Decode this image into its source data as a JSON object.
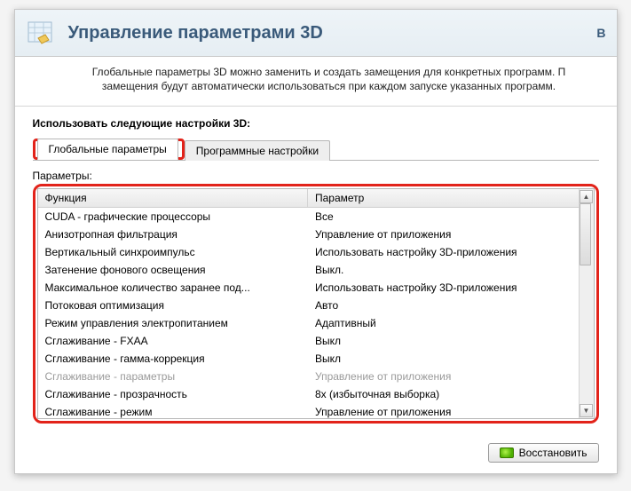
{
  "header": {
    "title": "Управление параметрами 3D",
    "rightChar": "В"
  },
  "description": "Глобальные параметры 3D можно заменить и создать замещения для конкретных программ. П замещения будут автоматически использоваться при каждом запуске указанных программ.",
  "sectionLabel": "Использовать следующие настройки 3D:",
  "tabs": {
    "global": "Глобальные параметры",
    "program": "Программные настройки"
  },
  "paramsLabel": "Параметры:",
  "columns": {
    "func": "Функция",
    "param": "Параметр"
  },
  "rows": [
    {
      "func": "CUDA - графические процессоры",
      "param": "Все",
      "disabled": false
    },
    {
      "func": "Анизотропная фильтрация",
      "param": "Управление от приложения",
      "disabled": false
    },
    {
      "func": "Вертикальный синхроимпульс",
      "param": "Использовать настройку 3D-приложения",
      "disabled": false
    },
    {
      "func": "Затенение фонового освещения",
      "param": "Выкл.",
      "disabled": false
    },
    {
      "func": "Максимальное количество заранее под...",
      "param": "Использовать настройку 3D-приложения",
      "disabled": false
    },
    {
      "func": "Потоковая оптимизация",
      "param": "Авто",
      "disabled": false
    },
    {
      "func": "Режим управления электропитанием",
      "param": "Адаптивный",
      "disabled": false
    },
    {
      "func": "Сглаживание - FXAA",
      "param": "Выкл",
      "disabled": false
    },
    {
      "func": "Сглаживание - гамма-коррекция",
      "param": "Выкл",
      "disabled": false
    },
    {
      "func": "Сглаживание - параметры",
      "param": "Управление от приложения",
      "disabled": true
    },
    {
      "func": "Сглаживание - прозрачность",
      "param": "8x (избыточная выборка)",
      "disabled": false
    },
    {
      "func": "Сглаживание - режим",
      "param": "Управление от приложения",
      "disabled": false
    }
  ],
  "restoreBtn": "Восстановить"
}
